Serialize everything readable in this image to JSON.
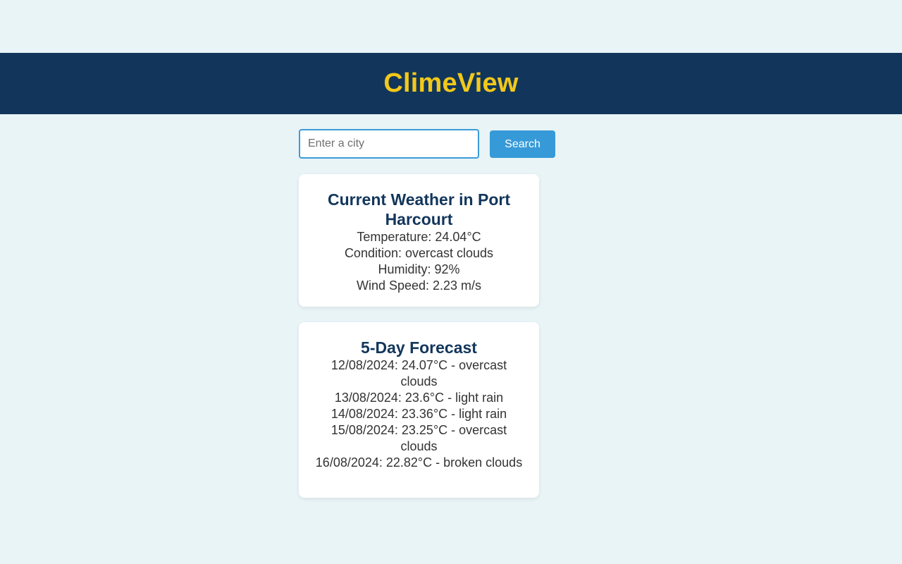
{
  "header": {
    "title": "ClimeView"
  },
  "search": {
    "placeholder": "Enter a city",
    "value": "",
    "button_label": "Search"
  },
  "current": {
    "title": "Current Weather in Port Harcourt",
    "temperature": "Temperature: 24.04°C",
    "condition": "Condition: overcast clouds",
    "humidity": "Humidity: 92%",
    "wind_speed": "Wind Speed: 2.23 m/s"
  },
  "forecast": {
    "title": "5-Day Forecast",
    "items": [
      "12/08/2024: 24.07°C - overcast clouds",
      "13/08/2024: 23.6°C - light rain",
      "14/08/2024: 23.36°C - light rain",
      "15/08/2024: 23.25°C - overcast clouds",
      "16/08/2024: 22.82°C - broken clouds"
    ]
  },
  "colors": {
    "background": "#e8f4f6",
    "header_bg": "#12365b",
    "title_accent": "#f2c81a",
    "button": "#379ad8",
    "card_title": "#12365b"
  }
}
